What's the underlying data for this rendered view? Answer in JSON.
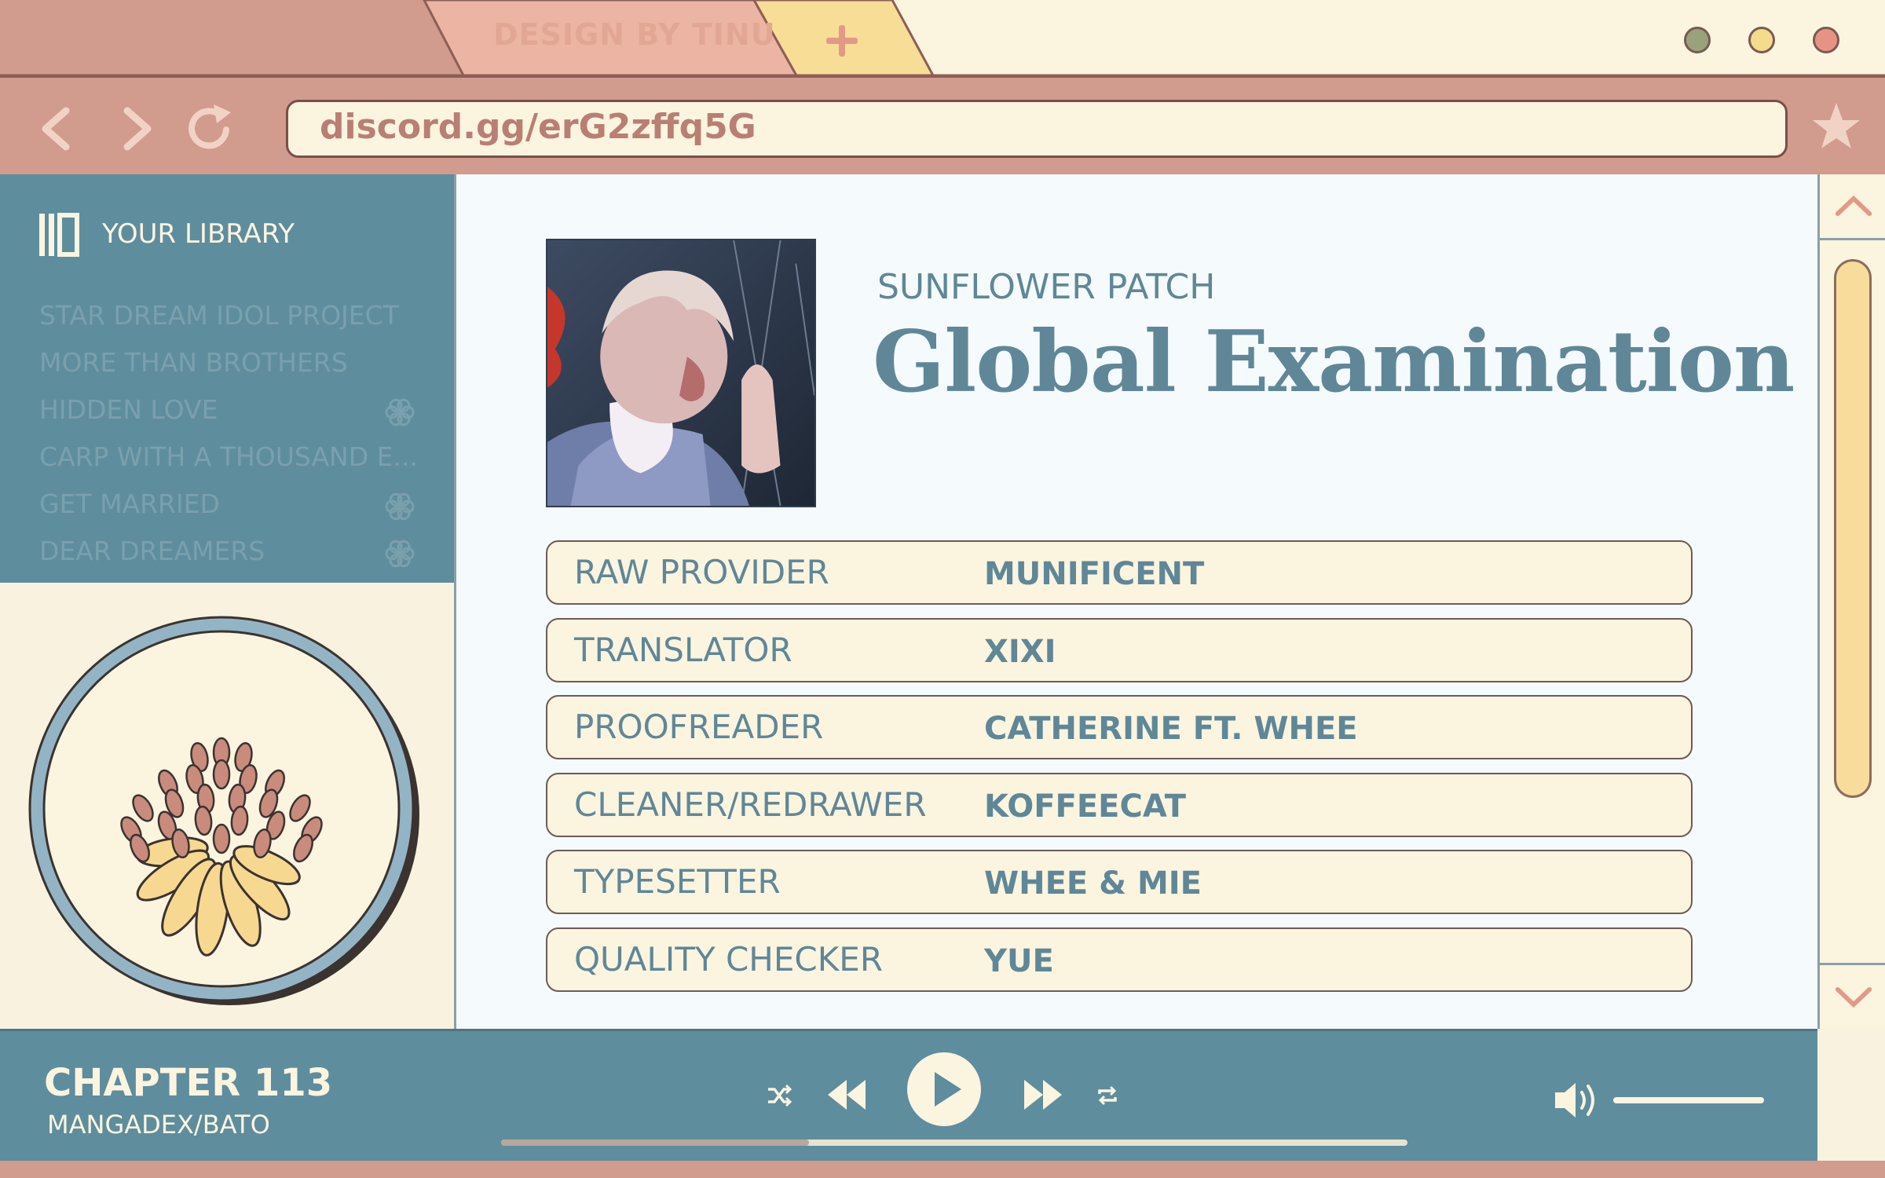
{
  "browser": {
    "tab_label": "DESIGN BY TINU",
    "new_tab_icon": "plus-icon",
    "address": "discord.gg/erG2zffq5G",
    "window_dots": [
      "#8f9a6e",
      "#f3dc8c",
      "#e79384"
    ]
  },
  "sidebar": {
    "title": "YOUR LIBRARY",
    "items": [
      {
        "label": "STAR DREAM IDOL PROJECT",
        "flower": false
      },
      {
        "label": "MORE THAN BROTHERS",
        "flower": false
      },
      {
        "label": "HIDDEN LOVE",
        "flower": true
      },
      {
        "label": "CARP WITH A THOUSAND E...",
        "flower": false
      },
      {
        "label": "GET MARRIED",
        "flower": true
      },
      {
        "label": "DEAR DREAMERS",
        "flower": true
      }
    ]
  },
  "main": {
    "team": "SUNFLOWER PATCH",
    "title": "Global Examination",
    "credits": [
      {
        "role": "RAW PROVIDER",
        "name": "MUNIFICENT"
      },
      {
        "role": "TRANSLATOR",
        "name": "XIXI"
      },
      {
        "role": "PROOFREADER",
        "name": "CATHERINE FT. WHEE"
      },
      {
        "role": "CLEANER/REDRAWER",
        "name": "KOFFEECAT"
      },
      {
        "role": "TYPESETTER",
        "name": "WHEE & MIE"
      },
      {
        "role": "QUALITY CHECKER",
        "name": "YUE"
      }
    ]
  },
  "player": {
    "chapter": "CHAPTER 113",
    "source": "MANGADEX/BATO",
    "progress": 0.34,
    "volume": 1.0
  },
  "colors": {
    "salmon": "#d19b8e",
    "teal": "#5e8d9e",
    "cream": "#fbf4df",
    "yellow": "#f7dc9c"
  }
}
